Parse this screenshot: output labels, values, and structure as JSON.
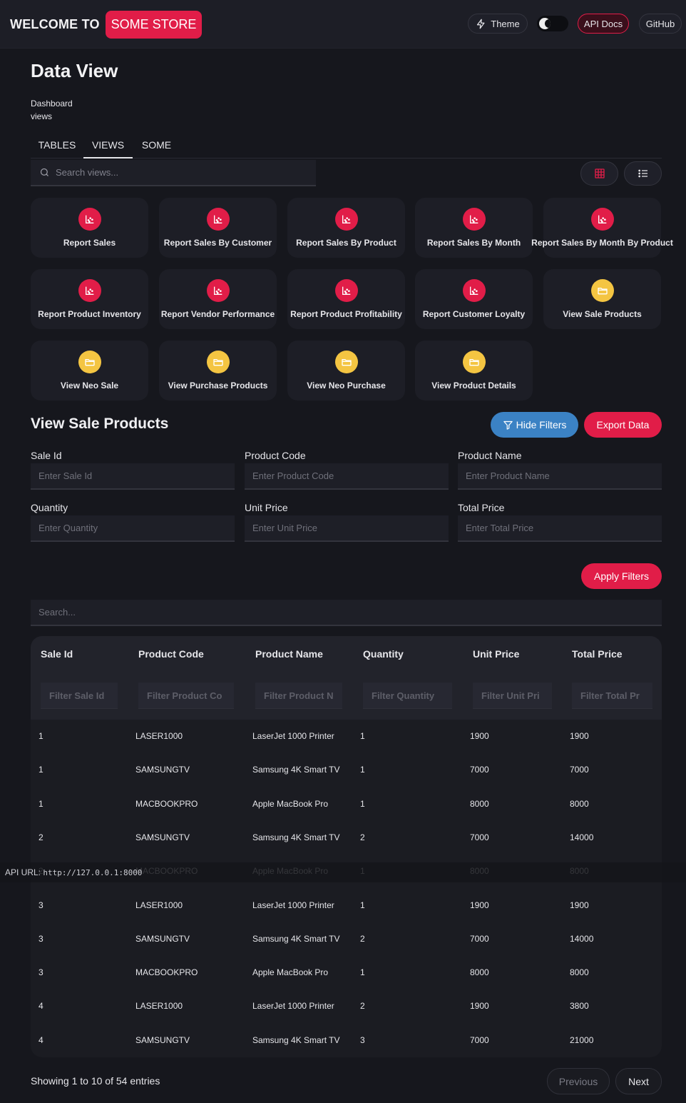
{
  "brand": {
    "prefix": "WELCOME TO",
    "name": "SOME STORE"
  },
  "nav": {
    "theme_label": "Theme",
    "api_docs_label": "API Docs",
    "github_label": "GitHub"
  },
  "header": {
    "title": "Data View",
    "breadcrumb": [
      "Dashboard",
      "views"
    ]
  },
  "tabs": [
    {
      "label": "TABLES"
    },
    {
      "label": "VIEWS",
      "active": true
    },
    {
      "label": "SOME"
    }
  ],
  "views_search": {
    "placeholder": "Search views..."
  },
  "cards": [
    {
      "label": "Report Sales",
      "icon": "chart-icon",
      "color": "#e11d48"
    },
    {
      "label": "Report Sales By Customer",
      "icon": "chart-icon",
      "color": "#e11d48"
    },
    {
      "label": "Report Sales By Product",
      "icon": "chart-icon",
      "color": "#e11d48"
    },
    {
      "label": "Report Sales By Month",
      "icon": "chart-icon",
      "color": "#e11d48"
    },
    {
      "label": "Report Sales By Month By Product",
      "icon": "chart-icon",
      "color": "#e11d48"
    },
    {
      "label": "Report Product Inventory",
      "icon": "chart-icon",
      "color": "#e11d48"
    },
    {
      "label": "Report Vendor Performance",
      "icon": "chart-icon",
      "color": "#e11d48"
    },
    {
      "label": "Report Product Profitability",
      "icon": "chart-icon",
      "color": "#e11d48"
    },
    {
      "label": "Report Customer Loyalty",
      "icon": "chart-icon",
      "color": "#e11d48"
    },
    {
      "label": "View Sale Products",
      "icon": "folder-icon",
      "color": "#f4c542"
    },
    {
      "label": "View Neo Sale",
      "icon": "folder-icon",
      "color": "#f4c542"
    },
    {
      "label": "View Purchase Products",
      "icon": "folder-icon",
      "color": "#f4c542"
    },
    {
      "label": "View Neo Purchase",
      "icon": "folder-icon",
      "color": "#f4c542"
    },
    {
      "label": "View Product Details",
      "icon": "folder-icon",
      "color": "#f4c542"
    }
  ],
  "section": {
    "title": "View Sale Products",
    "hide_filters_label": "Hide Filters",
    "export_label": "Export Data",
    "apply_label": "Apply Filters"
  },
  "filters": [
    {
      "label": "Sale Id",
      "placeholder": "Enter Sale Id"
    },
    {
      "label": "Product Code",
      "placeholder": "Enter Product Code"
    },
    {
      "label": "Product Name",
      "placeholder": "Enter Product Name"
    },
    {
      "label": "Quantity",
      "placeholder": "Enter Quantity"
    },
    {
      "label": "Unit Price",
      "placeholder": "Enter Unit Price"
    },
    {
      "label": "Total Price",
      "placeholder": "Enter Total Price"
    }
  ],
  "table_search": {
    "placeholder": "Search..."
  },
  "table": {
    "columns": [
      {
        "header": "Sale Id",
        "filter_placeholder": "Filter Sale Id"
      },
      {
        "header": "Product Code",
        "filter_placeholder": "Filter Product Co"
      },
      {
        "header": "Product Name",
        "filter_placeholder": "Filter Product N"
      },
      {
        "header": "Quantity",
        "filter_placeholder": "Filter Quantity"
      },
      {
        "header": "Unit Price",
        "filter_placeholder": "Filter Unit Pri"
      },
      {
        "header": "Total Price",
        "filter_placeholder": "Filter Total Pr"
      }
    ],
    "rows": [
      [
        "1",
        "LASER1000",
        "LaserJet 1000 Printer",
        "1",
        "1900",
        "1900"
      ],
      [
        "1",
        "SAMSUNGTV",
        "Samsung 4K Smart TV",
        "1",
        "7000",
        "7000"
      ],
      [
        "1",
        "MACBOOKPRO",
        "Apple MacBook Pro",
        "1",
        "8000",
        "8000"
      ],
      [
        "2",
        "SAMSUNGTV",
        "Samsung 4K Smart TV",
        "2",
        "7000",
        "14000"
      ],
      [
        "2",
        "MACBOOKPRO",
        "Apple MacBook Pro",
        "1",
        "8000",
        "8000"
      ],
      [
        "3",
        "LASER1000",
        "LaserJet 1000 Printer",
        "1",
        "1900",
        "1900"
      ],
      [
        "3",
        "SAMSUNGTV",
        "Samsung 4K Smart TV",
        "2",
        "7000",
        "14000"
      ],
      [
        "3",
        "MACBOOKPRO",
        "Apple MacBook Pro",
        "1",
        "8000",
        "8000"
      ],
      [
        "4",
        "LASER1000",
        "LaserJet 1000 Printer",
        "2",
        "1900",
        "3800"
      ],
      [
        "4",
        "SAMSUNGTV",
        "Samsung 4K Smart TV",
        "3",
        "7000",
        "21000"
      ]
    ]
  },
  "api_url": {
    "label": "API URL:",
    "value": "http://127.0.0.1:8000"
  },
  "pagination": {
    "showing_text": "Showing 1 to 10 of 54 entries",
    "prev_label": "Previous",
    "next_label": "Next"
  }
}
